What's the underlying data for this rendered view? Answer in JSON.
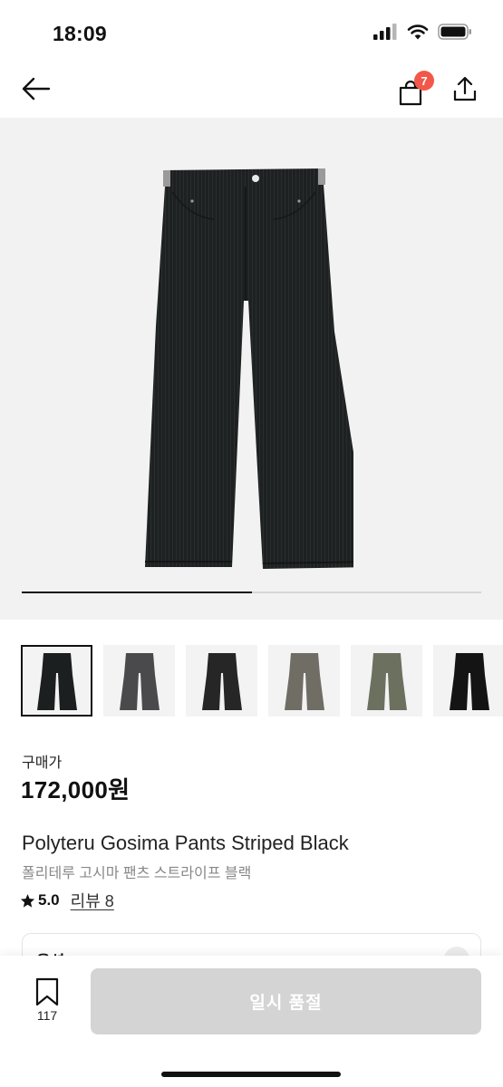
{
  "status_bar": {
    "time": "18:09"
  },
  "header": {
    "cart_count": "7"
  },
  "gallery": {
    "progress": 0.5,
    "thumbnails": [
      {
        "color": "#1c1f1f",
        "selected": true
      },
      {
        "color": "#4a4a4c",
        "selected": false
      },
      {
        "color": "#262626",
        "selected": false
      },
      {
        "color": "#6f6d64",
        "selected": false
      },
      {
        "color": "#6c705f",
        "selected": false
      },
      {
        "color": "#141414",
        "selected": false
      }
    ]
  },
  "product": {
    "price_label": "구매가",
    "price": "172,000원",
    "name": "Polyteru Gosima Pants Striped Black",
    "name_ko": "폴리테루 고시마 팬츠 스트라이프 블랙",
    "rating": "5.0",
    "review_label": "리뷰 8"
  },
  "option": {
    "label": "옵션"
  },
  "bottom_bar": {
    "wish_count": "117",
    "button_label": "일시 품절"
  },
  "colors": {
    "badge": "#f2584a",
    "disabled_button": "#d4d4d4"
  }
}
